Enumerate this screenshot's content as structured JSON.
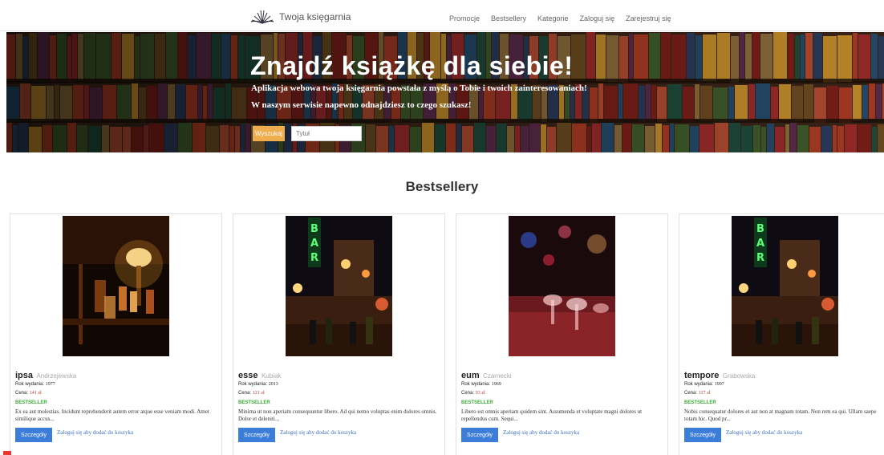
{
  "brand": {
    "name": "Twoja księgarnia",
    "logo_icon": "open-book-icon"
  },
  "nav": {
    "items": [
      "Promocje",
      "Bestsellery",
      "Kategorie",
      "Zaloguj się",
      "Zarejestruj się"
    ]
  },
  "hero": {
    "title": "Znajdź książkę dla siebie!",
    "line1": "Aplikacja webowa twoja księgarnia powstała z myślą o Tobie i twoich zainteresowaniach!",
    "line2": "W naszym serwisie napewno odnajdziesz to czego szukasz!",
    "search_button": "Wyszukaj",
    "search_placeholder": "Tytuł"
  },
  "section": {
    "title": "Bestsellery"
  },
  "labels": {
    "year": "Rok wydania:",
    "price": "Cena:",
    "currency": "zł",
    "badge": "BESTSELLER",
    "details": "Szczegóły",
    "login_to_add": "Zaloguj się aby dodać do koszyka"
  },
  "colors": {
    "accent_orange": "#f0ad4e",
    "button_blue": "#3b7dd8",
    "badge_green": "#3aaa35",
    "price_red": "#c0392b"
  },
  "books": [
    {
      "title": "ipsa",
      "author": "Andrzejewska",
      "year": "1977",
      "price": "141",
      "desc": "Ex ea aut molestias. Incidunt reprehenderit autem error atque esse veniam modi. Amet similique accus..."
    },
    {
      "title": "esse",
      "author": "Kubiak",
      "year": "2013",
      "price": "121",
      "desc": "Minima ut non aperiam consequuntur libero. Ad qui nemo voluptas enim dolores omnis. Dolor et deleniti..."
    },
    {
      "title": "eum",
      "author": "Czarnecki",
      "year": "1969",
      "price": "93",
      "desc": "Libero est omnis aperiam quidem sint. Assumenda et voluptate magni dolores ut repellendus cum. Sequi..."
    },
    {
      "title": "tempore",
      "author": "Grabowska",
      "year": "1997",
      "price": "117",
      "desc": "Nobis consequatur dolores et aut non at magnam totam. Non rem ea qui. Ullam saepe totam hic. Quod pr..."
    }
  ]
}
